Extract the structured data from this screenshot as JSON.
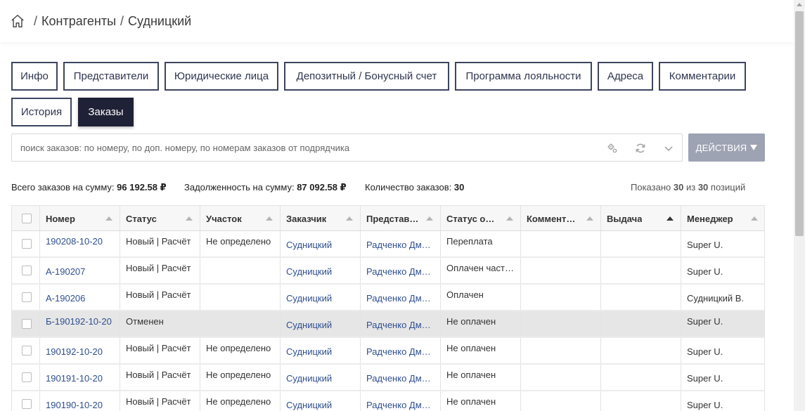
{
  "breadcrumb": {
    "sep1": "/",
    "item1": "Контрагенты",
    "sep2": "/",
    "item2": "Судницкий"
  },
  "tabs": [
    {
      "label": "Инфо",
      "active": false
    },
    {
      "label": "Представители",
      "active": false
    },
    {
      "label": "Юридические лица",
      "active": false
    },
    {
      "label": "Депозитный / Бонусный счет",
      "active": false
    },
    {
      "label": "Программа лояльности",
      "active": false
    },
    {
      "label": "Адреса",
      "active": false
    },
    {
      "label": "Комментарии",
      "active": false
    },
    {
      "label": "История",
      "active": false
    },
    {
      "label": "Заказы",
      "active": true
    }
  ],
  "search": {
    "placeholder": "поиск заказов: по номеру, по доп. номеру, по номерам заказов от подрядчика",
    "value": ""
  },
  "actions_label": "ДЕЙСТВИЯ",
  "summary": {
    "total_label": "Всего заказов на сумму:",
    "total_value": "96 192.58 ₽",
    "debt_label": "Задолженность на сумму:",
    "debt_value": "87 092.58 ₽",
    "count_label": "Количество заказов:",
    "count_value": "30",
    "shown_prefix": "Показано",
    "shown_value": "30",
    "shown_of": "из",
    "shown_total": "30",
    "shown_suffix": "позиций"
  },
  "table": {
    "columns": [
      "Номер",
      "Статус",
      "Участок",
      "Заказчик",
      "Представитель",
      "Статус оплаты",
      "Комментарий",
      "Выдача",
      "Менеджер"
    ],
    "rows": [
      {
        "number": "190208-10-20",
        "status": "Новый | Расчёт",
        "area": "Не определено",
        "customer": "Судницкий",
        "rep": "Радченко Дмитрий",
        "pay": "Переплата",
        "comment": "",
        "issue": "",
        "manager": "Super U."
      },
      {
        "number": "А-190207",
        "status": "Новый | Расчёт",
        "area": "",
        "customer": "Судницкий",
        "rep": "Радченко Дмитрий",
        "pay": "Оплачен частично",
        "comment": "",
        "issue": "",
        "manager": "Super U."
      },
      {
        "number": "А-190206",
        "status": "Новый | Расчёт",
        "area": "",
        "customer": "Судницкий",
        "rep": "Радченко Дмитрий",
        "pay": "Оплачен",
        "comment": "",
        "issue": "",
        "manager": "Судницкий В."
      },
      {
        "number": "Б-190192-10-20",
        "status": "Отменен",
        "area": "",
        "customer": "Судницкий",
        "rep": "Радченко Дмитрий",
        "pay": "Не оплачен",
        "comment": "",
        "issue": "",
        "manager": "Super U."
      },
      {
        "number": "190192-10-20",
        "status": "Новый | Расчёт",
        "area": "Не определено",
        "customer": "Судницкий",
        "rep": "Радченко Дмитрий",
        "pay": "Не оплачен",
        "comment": "",
        "issue": "",
        "manager": "Super U."
      },
      {
        "number": "190191-10-20",
        "status": "Новый | Расчёт",
        "area": "Не определено",
        "customer": "Судницкий",
        "rep": "Радченко Дмитрий",
        "pay": "Не оплачен",
        "comment": "",
        "issue": "",
        "manager": "Super U."
      },
      {
        "number": "190190-10-20",
        "status": "Новый | Расчёт",
        "area": "Не определено",
        "customer": "Судницкий",
        "rep": "Радченко Дмитрий",
        "pay": "Не оплачен",
        "comment": "",
        "issue": "",
        "manager": "Super U."
      }
    ]
  },
  "colors": {
    "link": "#2f4f8f",
    "tab_border": "#3c4560",
    "tab_active_bg": "#1f2137",
    "actions_bg": "#9ea3b3",
    "shaded_row": "#e6e6e6"
  },
  "icons": {
    "home": "home-icon",
    "settings": "gears-icon",
    "refresh": "refresh-icon",
    "expand": "chevron-down-icon",
    "actions": "caret-down-icon"
  }
}
